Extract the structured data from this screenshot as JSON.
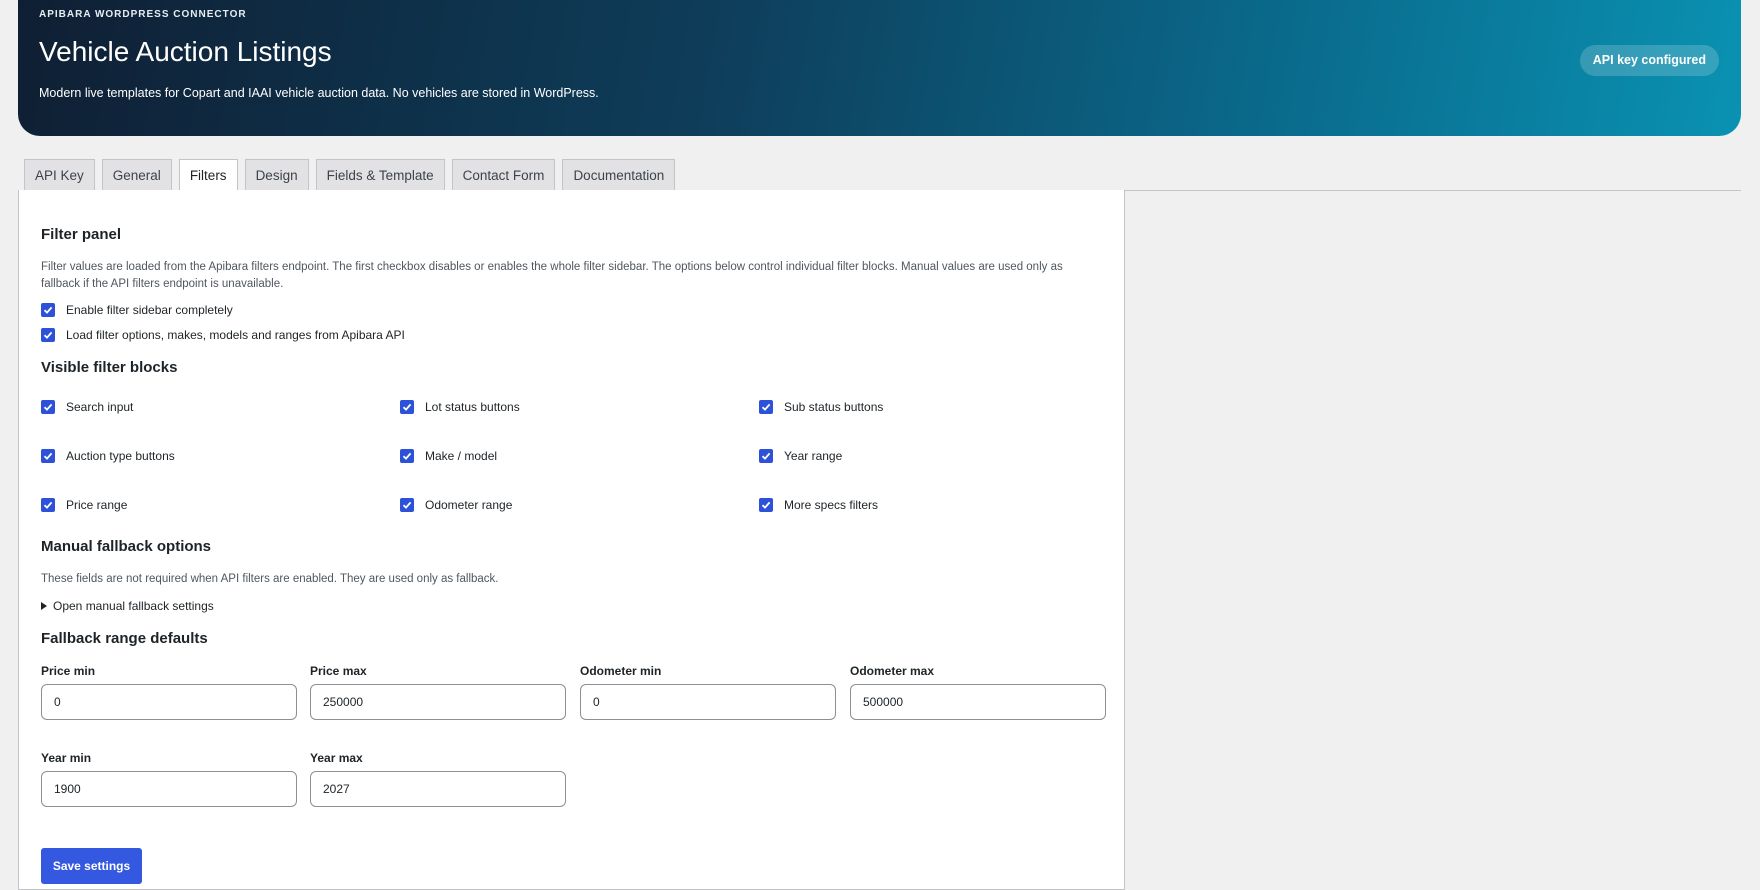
{
  "header": {
    "kicker": "APIBARA WORDPRESS CONNECTOR",
    "title": "Vehicle Auction Listings",
    "subtitle": "Modern live templates for Copart and IAAI vehicle auction data. No vehicles are stored in WordPress.",
    "badge": "API key configured"
  },
  "tabs": [
    {
      "label": "API Key",
      "active": false
    },
    {
      "label": "General",
      "active": false
    },
    {
      "label": "Filters",
      "active": true
    },
    {
      "label": "Design",
      "active": false
    },
    {
      "label": "Fields & Template",
      "active": false
    },
    {
      "label": "Contact Form",
      "active": false
    },
    {
      "label": "Documentation",
      "active": false
    }
  ],
  "filter_panel": {
    "heading": "Filter panel",
    "description": "Filter values are loaded from the Apibara filters endpoint. The first checkbox disables or enables the whole filter sidebar. The options below control individual filter blocks. Manual values are used only as fallback if the API filters endpoint is unavailable.",
    "options": [
      {
        "label": "Enable filter sidebar completely",
        "checked": true
      },
      {
        "label": "Load filter options, makes, models and ranges from Apibara API",
        "checked": true
      }
    ]
  },
  "visible_blocks": {
    "heading": "Visible filter blocks",
    "items": [
      {
        "label": "Search input",
        "checked": true
      },
      {
        "label": "Lot status buttons",
        "checked": true
      },
      {
        "label": "Sub status buttons",
        "checked": true
      },
      {
        "label": "Auction type buttons",
        "checked": true
      },
      {
        "label": "Make / model",
        "checked": true
      },
      {
        "label": "Year range",
        "checked": true
      },
      {
        "label": "Price range",
        "checked": true
      },
      {
        "label": "Odometer range",
        "checked": true
      },
      {
        "label": "More specs filters",
        "checked": true
      }
    ]
  },
  "manual_fallback": {
    "heading": "Manual fallback options",
    "description": "These fields are not required when API filters are enabled. They are used only as fallback.",
    "toggle_label": "Open manual fallback settings"
  },
  "range_defaults": {
    "heading": "Fallback range defaults",
    "fields": [
      {
        "label": "Price min",
        "value": "0"
      },
      {
        "label": "Price max",
        "value": "250000"
      },
      {
        "label": "Odometer min",
        "value": "0"
      },
      {
        "label": "Odometer max",
        "value": "500000"
      },
      {
        "label": "Year min",
        "value": "1900"
      },
      {
        "label": "Year max",
        "value": "2027"
      }
    ]
  },
  "save_button": "Save settings",
  "colors": {
    "accent": "#3458e0",
    "checkbox": "#2d51d8"
  }
}
